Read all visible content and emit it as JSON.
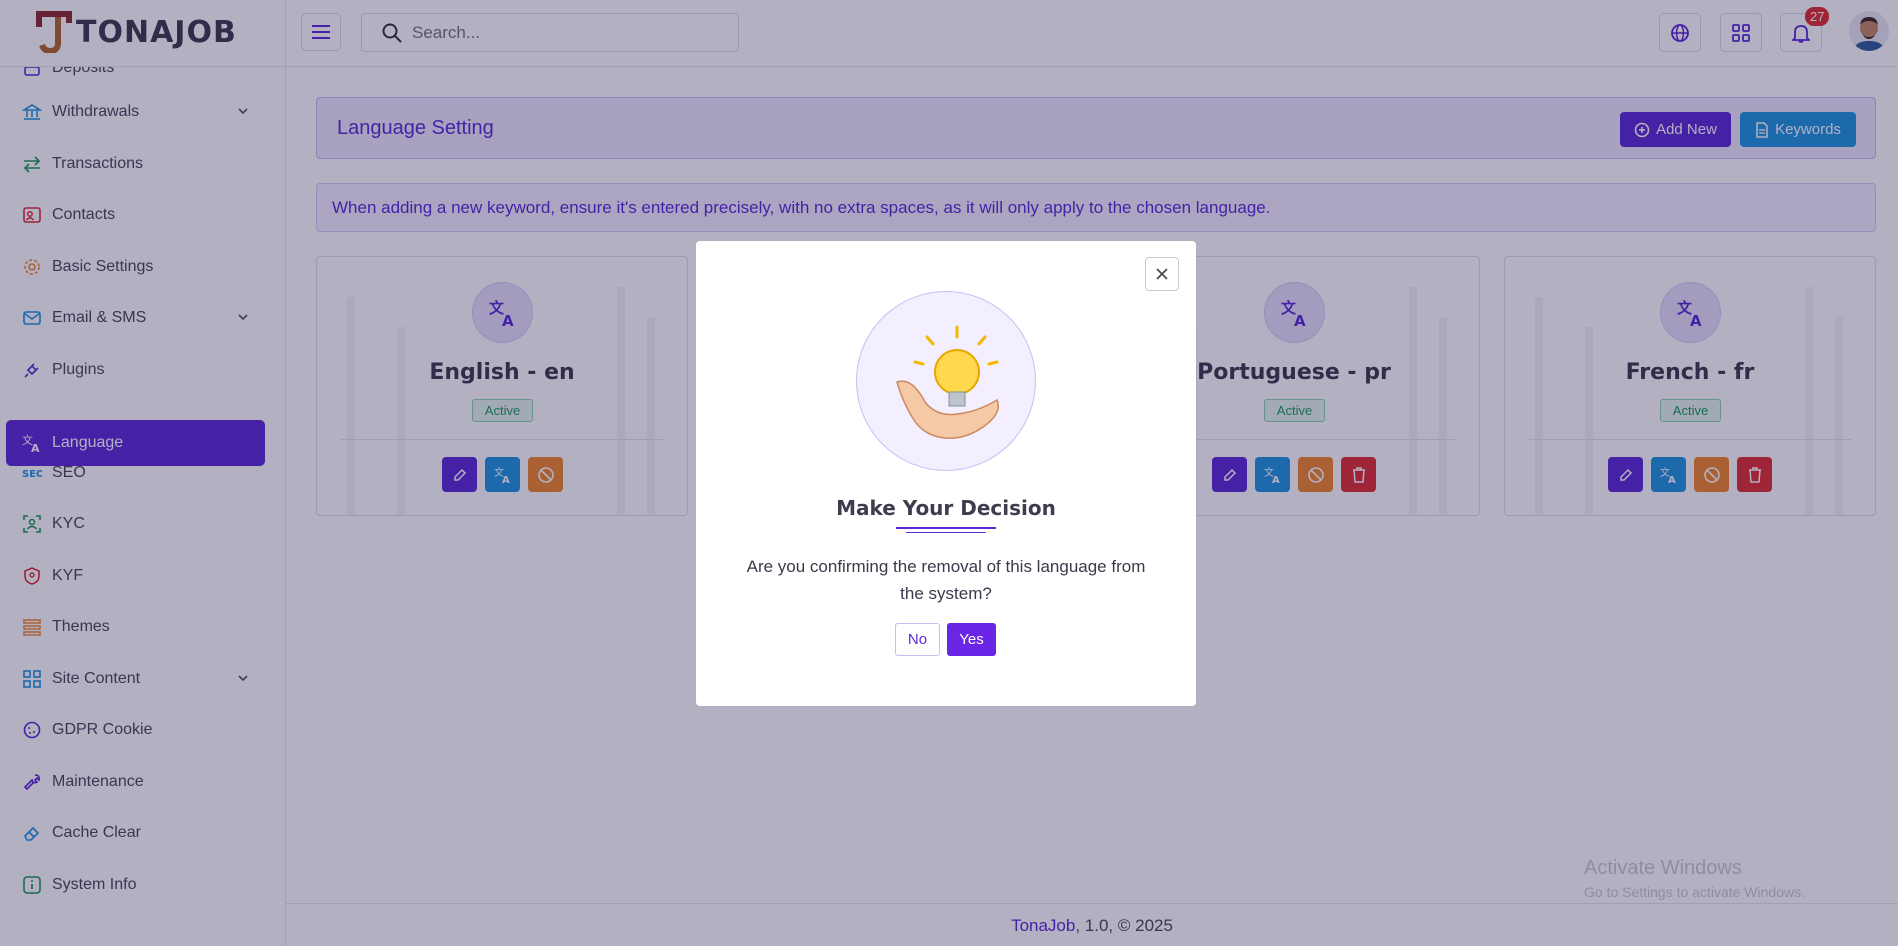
{
  "brand": {
    "logo_text": "TONAJOB"
  },
  "header": {
    "search_placeholder": "Search...",
    "notification_count": "27"
  },
  "sidebar": {
    "items": [
      {
        "label": "Deposits",
        "icon": "deposit-icon"
      },
      {
        "label": "Withdrawals",
        "icon": "bank-icon",
        "has_submenu": true
      },
      {
        "label": "Transactions",
        "icon": "arrows-exchange-icon"
      },
      {
        "label": "Contacts",
        "icon": "contact-card-icon"
      },
      {
        "label": "Basic Settings",
        "icon": "gear-icon"
      },
      {
        "label": "Email & SMS",
        "icon": "mail-icon",
        "has_submenu": true
      },
      {
        "label": "Plugins",
        "icon": "plug-icon"
      },
      {
        "label": "Language",
        "icon": "translate-icon",
        "active": true
      },
      {
        "label": "SEO",
        "icon": "seo-icon"
      },
      {
        "label": "KYC",
        "icon": "scan-user-icon"
      },
      {
        "label": "KYF",
        "icon": "user-shield-icon"
      },
      {
        "label": "Themes",
        "icon": "layers-icon"
      },
      {
        "label": "Site Content",
        "icon": "grid-icon",
        "has_submenu": true
      },
      {
        "label": "GDPR Cookie",
        "icon": "cookie-icon"
      },
      {
        "label": "Maintenance",
        "icon": "wrench-icon"
      },
      {
        "label": "Cache Clear",
        "icon": "eraser-icon"
      },
      {
        "label": "System Info",
        "icon": "info-icon"
      }
    ]
  },
  "main": {
    "title": "Language Setting",
    "add_new_label": "Add New",
    "keywords_label": "Keywords",
    "notice": "When adding a new keyword, ensure it's entered precisely, with no extra spaces, as it will only apply to the chosen language.",
    "cards": [
      {
        "name": "English - en",
        "status": "Active",
        "actions": [
          "edit",
          "translate",
          "disable"
        ]
      },
      {
        "name": "Portuguese - pr",
        "status": "Active",
        "actions": [
          "edit",
          "translate",
          "disable",
          "delete"
        ]
      },
      {
        "name": "French - fr",
        "status": "Active",
        "actions": [
          "edit",
          "translate",
          "disable",
          "delete"
        ]
      }
    ]
  },
  "footer": {
    "brand": "TonaJob",
    "rest": ", 1.0, © 2025"
  },
  "watermark": {
    "line1": "Activate Windows",
    "line2": "Go to Settings to activate Windows."
  },
  "modal": {
    "title": "Make Your Decision",
    "message": "Are you confirming the removal of this language from the system?",
    "no_label": "No",
    "yes_label": "Yes",
    "image": "light-bulb-in-hand-illustration"
  },
  "colors": {
    "primary": "#5b2bd6",
    "info": "#1f96de",
    "warning": "#f08a2c",
    "danger": "#e03131",
    "success": "#1f9a58"
  }
}
